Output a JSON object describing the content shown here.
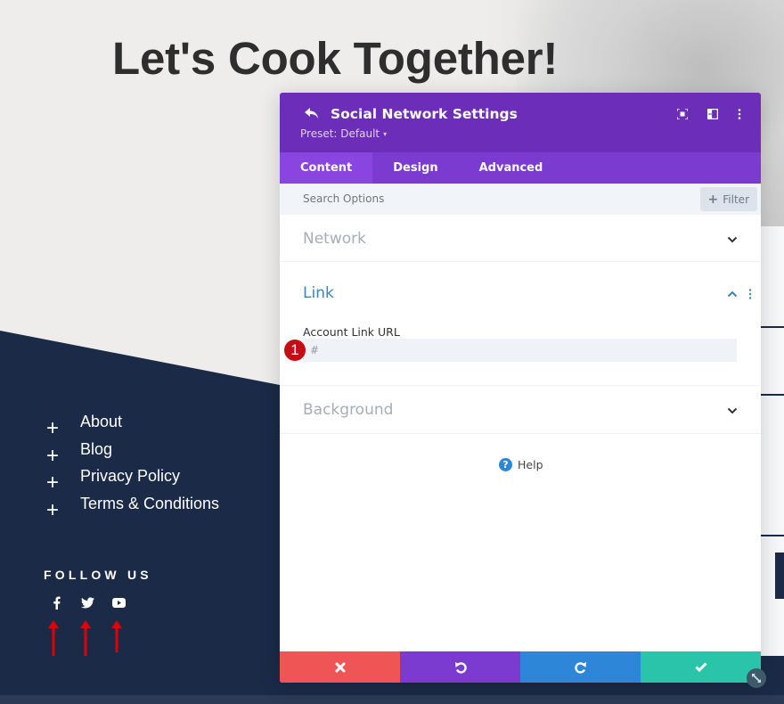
{
  "page": {
    "hero_title": "Let's Cook Together!",
    "footer_links": [
      {
        "label": "About"
      },
      {
        "label": "Blog"
      },
      {
        "label": "Privacy Policy"
      },
      {
        "label": "Terms & Conditions"
      }
    ],
    "plus_glyph": "+",
    "follow_title": "FOLLOW US",
    "social_icons": [
      "facebook-icon",
      "twitter-icon",
      "youtube-icon"
    ],
    "colors": {
      "footer_bg": "#1b2a47",
      "arrow": "#e00000"
    }
  },
  "modal": {
    "title": "Social Network Settings",
    "preset_label": "Preset: Default",
    "preset_caret": "▾",
    "header_icons": [
      "focus-icon",
      "split-view-icon",
      "more-options-icon"
    ],
    "tabs": [
      {
        "label": "Content",
        "active": true
      },
      {
        "label": "Design",
        "active": false
      },
      {
        "label": "Advanced",
        "active": false
      }
    ],
    "search": {
      "placeholder": "Search Options"
    },
    "filter": {
      "plus": "+",
      "label": "Filter"
    },
    "sections": [
      {
        "title": "Network",
        "open": false
      },
      {
        "title": "Link",
        "open": true
      },
      {
        "title": "Background",
        "open": false
      }
    ],
    "link_section": {
      "field_label": "Account Link URL",
      "field_value": "#",
      "step_badge": "1"
    },
    "help": {
      "icon": "?",
      "label": "Help"
    },
    "actions": [
      {
        "name": "discard",
        "color": "#ef5555"
      },
      {
        "name": "undo",
        "color": "#7b3bd0"
      },
      {
        "name": "redo",
        "color": "#2e86d9"
      },
      {
        "name": "save",
        "color": "#29c4a9"
      }
    ],
    "colors": {
      "header": "#6c2eb9",
      "tabs": "#7b3bd0",
      "active_tab": "#8a45e0",
      "open_section": "#3a84c1"
    }
  }
}
